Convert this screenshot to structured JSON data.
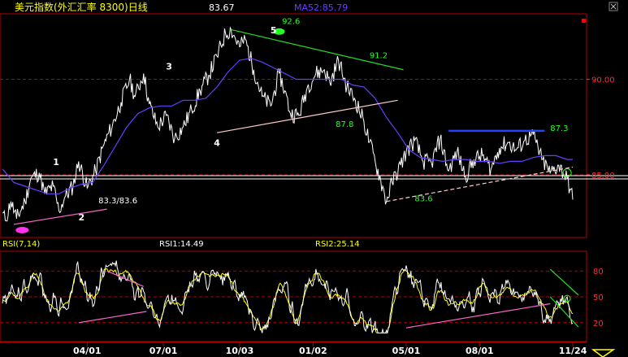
{
  "header": {
    "title": "美元指数(外汇汇率 8300)日线",
    "last_value": "83.67",
    "ma_label": "MA52:85.79"
  },
  "rsi_header": {
    "label": "RSI(7,14)",
    "rsi1": "RSI1:14.49",
    "rsi2": "RSI2:25.14"
  },
  "colors": {
    "price": "#ffffff",
    "ma": "#6a3cff",
    "rsi1": "#ffffff",
    "rsi2": "#ffff00",
    "grid": "#b40000",
    "trend_up": "#ff66cc",
    "trend_down": "#22dd22",
    "resistance": "#2244ff",
    "support_pale": "#ffcccc"
  },
  "chart_data": [
    {
      "type": "line",
      "panel": "price",
      "ylim": [
        81.8,
        93.3
      ],
      "yticks": [
        85.0,
        90.0
      ],
      "ytick_labels": [
        "85.00",
        "90.00"
      ],
      "grid": true,
      "price_path": [
        [
          0,
          83.0
        ],
        [
          1,
          82.6
        ],
        [
          3,
          83.6
        ],
        [
          5,
          82.7
        ],
        [
          8,
          83.6
        ],
        [
          10,
          84.8
        ],
        [
          13,
          85.1
        ],
        [
          15,
          84.0
        ],
        [
          18,
          84.4
        ],
        [
          20,
          83.1
        ],
        [
          22,
          83.8
        ],
        [
          25,
          84.4
        ],
        [
          27,
          85.7
        ],
        [
          30,
          84.3
        ],
        [
          33,
          85.2
        ],
        [
          36,
          86.6
        ],
        [
          39,
          87.6
        ],
        [
          42,
          88.8
        ],
        [
          45,
          90.0
        ],
        [
          47,
          89.1
        ],
        [
          50,
          90.3
        ],
        [
          52,
          88.7
        ],
        [
          55,
          87.5
        ],
        [
          58,
          88.1
        ],
        [
          61,
          86.9
        ],
        [
          64,
          87.5
        ],
        [
          67,
          88.4
        ],
        [
          70,
          89.4
        ],
        [
          73,
          90.2
        ],
        [
          76,
          91.2
        ],
        [
          79,
          92.4
        ],
        [
          81,
          92.6
        ],
        [
          84,
          91.7
        ],
        [
          86,
          92.1
        ],
        [
          89,
          90.5
        ],
        [
          92,
          89.1
        ],
        [
          95,
          88.6
        ],
        [
          98,
          90.3
        ],
        [
          100,
          89.4
        ],
        [
          102,
          88.2
        ],
        [
          105,
          88.1
        ],
        [
          108,
          89.6
        ],
        [
          111,
          90.3
        ],
        [
          114,
          90.5
        ],
        [
          116,
          89.8
        ],
        [
          119,
          91.0
        ],
        [
          122,
          89.6
        ],
        [
          125,
          88.9
        ],
        [
          128,
          87.8
        ],
        [
          130,
          86.7
        ],
        [
          132,
          85.7
        ],
        [
          134,
          84.7
        ],
        [
          136,
          83.6
        ],
        [
          138,
          84.6
        ],
        [
          141,
          85.5
        ],
        [
          143,
          86.2
        ],
        [
          146,
          86.8
        ],
        [
          149,
          85.7
        ],
        [
          152,
          85.6
        ],
        [
          155,
          86.9
        ],
        [
          158,
          85.2
        ],
        [
          161,
          86.2
        ],
        [
          164,
          84.9
        ],
        [
          167,
          85.8
        ],
        [
          170,
          86.0
        ],
        [
          173,
          85.3
        ],
        [
          176,
          86.4
        ],
        [
          179,
          86.7
        ],
        [
          182,
          86.3
        ],
        [
          185,
          86.8
        ],
        [
          188,
          87.1
        ],
        [
          191,
          85.8
        ],
        [
          194,
          85.1
        ],
        [
          197,
          85.5
        ],
        [
          200,
          84.8
        ],
        [
          202,
          83.7
        ]
      ],
      "ma_path": [
        [
          0,
          85.3
        ],
        [
          4,
          84.6
        ],
        [
          8,
          84.4
        ],
        [
          12,
          84.2
        ],
        [
          16,
          84.0
        ],
        [
          20,
          84.0
        ],
        [
          24,
          84.3
        ],
        [
          28,
          84.5
        ],
        [
          32,
          84.6
        ],
        [
          36,
          85.5
        ],
        [
          40,
          86.5
        ],
        [
          44,
          87.5
        ],
        [
          48,
          88.2
        ],
        [
          52,
          88.5
        ],
        [
          56,
          88.6
        ],
        [
          60,
          88.6
        ],
        [
          64,
          88.9
        ],
        [
          68,
          88.9
        ],
        [
          72,
          89.0
        ],
        [
          76,
          89.6
        ],
        [
          80,
          90.4
        ],
        [
          84,
          91.0
        ],
        [
          88,
          91.1
        ],
        [
          92,
          90.9
        ],
        [
          96,
          90.6
        ],
        [
          100,
          90.3
        ],
        [
          104,
          90.0
        ],
        [
          108,
          90.0
        ],
        [
          112,
          90.0
        ],
        [
          116,
          90.0
        ],
        [
          120,
          90.0
        ],
        [
          124,
          89.7
        ],
        [
          128,
          89.6
        ],
        [
          132,
          89.0
        ],
        [
          136,
          88.0
        ],
        [
          140,
          87.2
        ],
        [
          144,
          86.3
        ],
        [
          148,
          85.9
        ],
        [
          152,
          85.8
        ],
        [
          156,
          85.7
        ],
        [
          160,
          85.8
        ],
        [
          164,
          85.8
        ],
        [
          168,
          85.7
        ],
        [
          172,
          85.7
        ],
        [
          176,
          85.6
        ],
        [
          180,
          85.7
        ],
        [
          184,
          85.7
        ],
        [
          188,
          85.9
        ],
        [
          192,
          86.0
        ],
        [
          196,
          86.0
        ],
        [
          200,
          85.8
        ],
        [
          202,
          85.8
        ]
      ],
      "trendlines": [
        {
          "from": [
            76,
            87.2
          ],
          "to": [
            140,
            88.9
          ],
          "style": "support_pale"
        },
        {
          "from": [
            81,
            92.6
          ],
          "to": [
            142,
            90.5
          ],
          "style": "trend_down"
        },
        {
          "from": [
            136,
            83.6
          ],
          "to": [
            202,
            85.4
          ],
          "style": "support_pale",
          "dashed": true
        },
        {
          "from": [
            4,
            82.4
          ],
          "to": [
            37,
            83.2
          ],
          "style": "trend_up"
        },
        {
          "from": [
            158,
            87.3
          ],
          "to": [
            192,
            87.3
          ],
          "style": "resistance"
        }
      ],
      "annotations": [
        {
          "text": "1",
          "x": 19,
          "y": 85.5
        },
        {
          "text": "2",
          "x": 28,
          "y": 82.6
        },
        {
          "text": "3",
          "x": 59,
          "y": 90.5
        },
        {
          "text": "4",
          "x": 76,
          "y": 86.5
        },
        {
          "text": "5",
          "x": 96,
          "y": 92.4
        },
        {
          "text": "92.6",
          "x": 99,
          "y": 92.9
        },
        {
          "text": "91.2",
          "x": 130,
          "y": 91.1
        },
        {
          "text": "87.8",
          "x": 118,
          "y": 87.5
        },
        {
          "text": "87.3",
          "x": 194,
          "y": 87.3
        },
        {
          "text": "83.6",
          "x": 146,
          "y": 83.6
        },
        {
          "text": "83.3/83.6",
          "x": 34,
          "y": 83.5
        }
      ],
      "markers": [
        {
          "kind": "pink-dot",
          "x": 7,
          "y": 82.1
        },
        {
          "kind": "green-dot",
          "x": 98,
          "y": 92.5
        },
        {
          "kind": "green-circle",
          "x": 200,
          "y": 85.1
        }
      ]
    },
    {
      "type": "line",
      "panel": "rsi",
      "ylim": [
        0,
        100
      ],
      "yticks": [
        20,
        50,
        80
      ],
      "ytick_labels": [
        "20",
        "50",
        "80"
      ],
      "grid": true,
      "xticks": [
        30,
        57,
        84,
        110,
        143,
        169,
        202
      ],
      "xtick_labels": [
        "04/01",
        "07/01",
        "10/03",
        "01/02",
        "05/01",
        "08/01",
        "11/24"
      ],
      "rsi1_seed": 3,
      "rsi2_seed": 7
    }
  ]
}
